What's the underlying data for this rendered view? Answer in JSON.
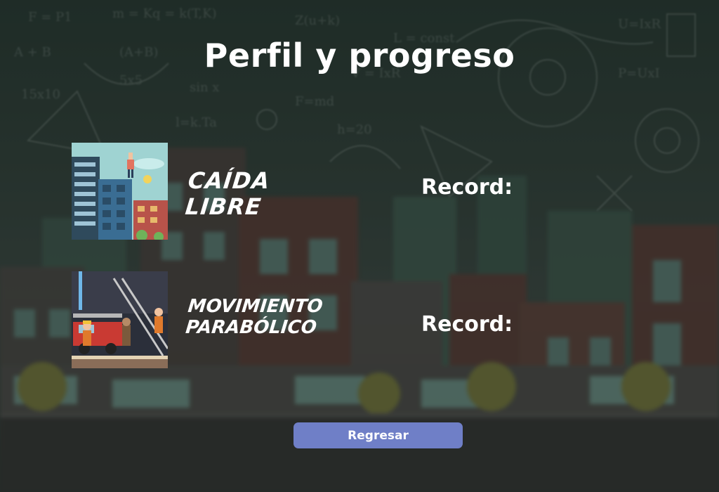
{
  "screen": {
    "title": "Perfil y progreso"
  },
  "games": [
    {
      "name_line1": "Caída",
      "name_line2": "Libre",
      "thumbnail_icon": "falling-building-thumbnail",
      "record_label": "Record:",
      "record_value": ""
    },
    {
      "name_line1": "Movimiento",
      "name_line2": "Parabólico",
      "thumbnail_icon": "firefighter-thumbnail",
      "record_label": "Record:",
      "record_value": ""
    }
  ],
  "back_button": {
    "label": "Regresar"
  },
  "colors": {
    "button": "#6f7fc7",
    "text": "#ffffff",
    "background": "#2e3c36"
  }
}
